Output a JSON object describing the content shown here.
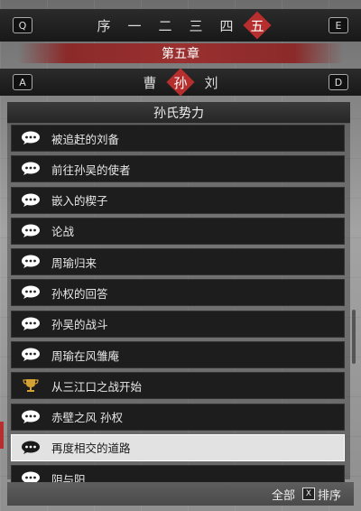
{
  "chapter_nav": {
    "key_left": "Q",
    "key_right": "E",
    "tabs": [
      "序",
      "一",
      "二",
      "三",
      "四",
      "五"
    ],
    "active_tab": 5
  },
  "chapter_title": "第五章",
  "faction_nav": {
    "key_left": "A",
    "key_right": "D",
    "tabs": [
      "曹",
      "孙",
      "刘"
    ],
    "active_tab": 1
  },
  "panel_title": "孙氏势力",
  "events": [
    {
      "label": "被追赶的刘备",
      "icon": "speech-bubble-icon"
    },
    {
      "label": "前往孙吴的使者",
      "icon": "speech-bubble-icon"
    },
    {
      "label": "嵌入的楔子",
      "icon": "speech-bubble-icon"
    },
    {
      "label": "论战",
      "icon": "speech-bubble-icon"
    },
    {
      "label": "周瑜归来",
      "icon": "speech-bubble-icon"
    },
    {
      "label": "孙权的回答",
      "icon": "speech-bubble-icon"
    },
    {
      "label": "孙吴的战斗",
      "icon": "speech-bubble-icon"
    },
    {
      "label": "周瑜在风雏庵",
      "icon": "speech-bubble-icon"
    },
    {
      "label": "从三江口之战开始",
      "icon": "trophy-icon"
    },
    {
      "label": "赤壁之风 孙权",
      "icon": "speech-bubble-icon"
    },
    {
      "label": "再度相交的道路",
      "icon": "speech-bubble-icon"
    },
    {
      "label": "阴与阳",
      "icon": "speech-bubble-icon"
    }
  ],
  "selected_event": 10,
  "footer": {
    "filter_label": "全部",
    "sort_key": "X",
    "sort_label": "排序"
  },
  "colors": {
    "accent": "#b72e2e",
    "item_bg": "#1d1d1d",
    "selected_bg": "#e2e2e2"
  }
}
